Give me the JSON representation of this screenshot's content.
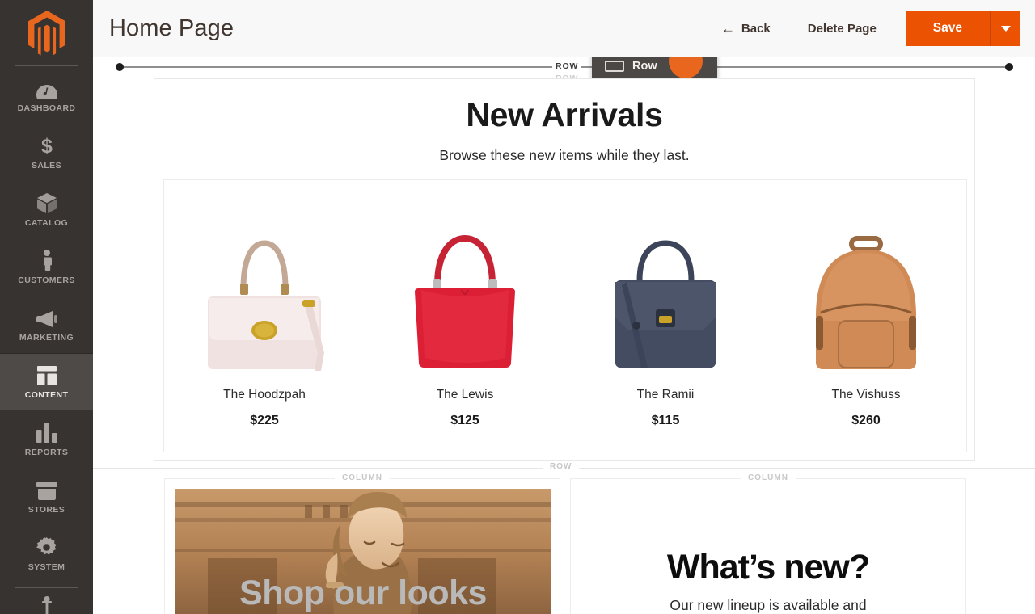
{
  "sidebar": {
    "logo_name": "magento-logo",
    "items": [
      {
        "label": "DASHBOARD",
        "icon": "dashboard-icon",
        "active": false
      },
      {
        "label": "SALES",
        "icon": "dollar-icon",
        "active": false
      },
      {
        "label": "CATALOG",
        "icon": "box-icon",
        "active": false
      },
      {
        "label": "CUSTOMERS",
        "icon": "person-icon",
        "active": false
      },
      {
        "label": "MARKETING",
        "icon": "megaphone-icon",
        "active": false
      },
      {
        "label": "CONTENT",
        "icon": "layout-icon",
        "active": true
      },
      {
        "label": "REPORTS",
        "icon": "bar-chart-icon",
        "active": false
      },
      {
        "label": "STORES",
        "icon": "store-box-icon",
        "active": false
      },
      {
        "label": "SYSTEM",
        "icon": "gear-icon",
        "active": false
      }
    ]
  },
  "header": {
    "title": "Home Page",
    "back_label": "Back",
    "back_icon": "arrow-left-icon",
    "delete_label": "Delete Page",
    "save_label": "Save",
    "save_caret_icon": "chevron-down-icon",
    "accent_color": "#eb5202"
  },
  "stage": {
    "drop_indicator": {
      "row_label": "ROW",
      "row_label_ghost": "ROW"
    },
    "drag_chip": {
      "label": "Row",
      "icon": "row-glyph-icon",
      "cursor_color": "#e8661e"
    },
    "row1": {
      "heading": "New Arrivals",
      "subheading": "Browse these new items while they last.",
      "products": [
        {
          "name": "The Hoodzpah",
          "price": "$225",
          "image": "blush-pink-satchel-handbag"
        },
        {
          "name": "The Lewis",
          "price": "$125",
          "image": "red-hobo-shoulder-bag"
        },
        {
          "name": "The Ramii",
          "price": "$115",
          "image": "navy-structured-satchel"
        },
        {
          "name": "The Vishuss",
          "price": "$260",
          "image": "tan-leather-backpack"
        }
      ]
    },
    "row2": {
      "row_label": "ROW",
      "column_left": {
        "label": "COLUMN",
        "banner_text": "Shop our looks",
        "banner_image": "sepia-photo-woman-smiling"
      },
      "column_right": {
        "label": "COLUMN",
        "heading": "What’s new?",
        "paragraph": "Our new lineup is available and"
      }
    }
  }
}
